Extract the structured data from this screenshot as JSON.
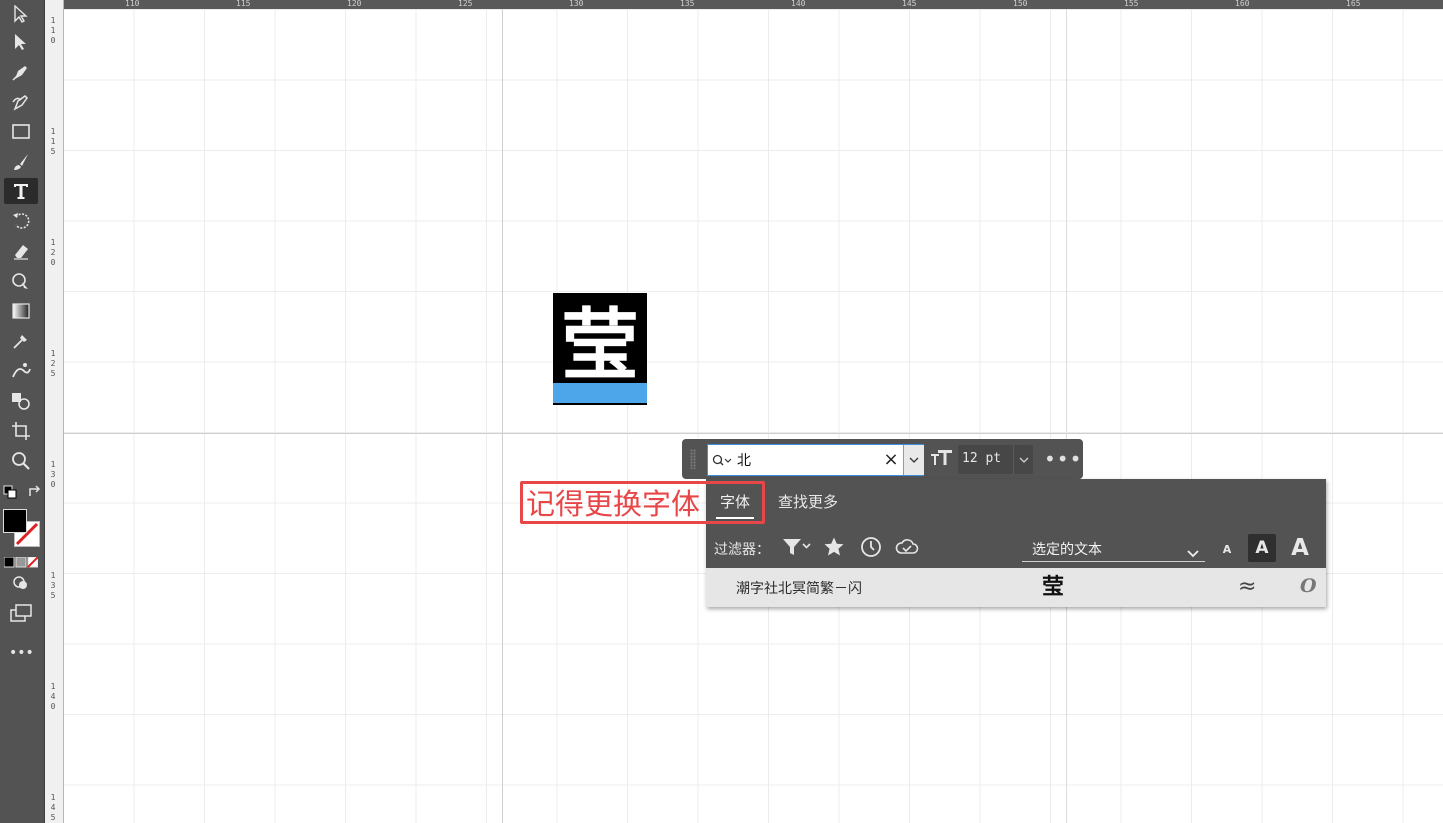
{
  "app": {
    "toolbar": {
      "tools": [
        {
          "name": "selection-tool-icon",
          "active": false
        },
        {
          "name": "direct-selection-tool-icon",
          "active": false
        },
        {
          "name": "pen-tool-icon",
          "active": false
        },
        {
          "name": "curvature-tool-icon",
          "active": false
        },
        {
          "name": "rectangle-tool-icon",
          "active": false
        },
        {
          "name": "paintbrush-tool-icon",
          "active": false
        },
        {
          "name": "type-tool-icon",
          "active": true
        },
        {
          "name": "rotate-tool-icon",
          "active": false
        },
        {
          "name": "eraser-tool-icon",
          "active": false
        },
        {
          "name": "warp-tool-icon",
          "active": false
        },
        {
          "name": "gradient-tool-icon",
          "active": false
        },
        {
          "name": "eyedropper-tool-icon",
          "active": false
        },
        {
          "name": "symbol-sprayer-tool-icon",
          "active": false
        },
        {
          "name": "shape-builder-tool-icon",
          "active": false
        },
        {
          "name": "artboard-tool-icon",
          "active": false
        },
        {
          "name": "zoom-tool-icon",
          "active": false
        }
      ],
      "fill_color": "#000000",
      "stroke": "none",
      "more_label": "•••"
    },
    "rulers": {
      "horizontal_ticks": [
        "110",
        "115",
        "120",
        "125",
        "130",
        "135",
        "140",
        "145",
        "150",
        "155",
        "160",
        "165"
      ],
      "vertical_ticks": [
        [
          "1",
          "1",
          "0"
        ],
        [
          "1",
          "1",
          "5"
        ],
        [
          "1",
          "2",
          "0"
        ],
        [
          "1",
          "2",
          "5"
        ],
        [
          "1",
          "3",
          "0"
        ],
        [
          "1",
          "3",
          "5"
        ],
        [
          "1",
          "4",
          "0"
        ],
        [
          "1",
          "4",
          "5"
        ]
      ]
    },
    "artwork": {
      "glyph": "莹",
      "background": "#000000",
      "selection_color": "#4da6ea"
    },
    "annotation": {
      "text": "记得更换字体",
      "color": "#e8474a"
    },
    "context_bar": {
      "search_value": "北",
      "clear_label": "×",
      "font_size_value": "12 pt",
      "more_label": "•••"
    },
    "font_panel": {
      "tabs": [
        {
          "label": "字体",
          "active": true
        },
        {
          "label": "查找更多",
          "active": false
        }
      ],
      "filter_label": "过滤器：",
      "sample_text_option": "选定的文本",
      "size_options": [
        "A",
        "A",
        "A"
      ],
      "results": [
        {
          "name": "潮字社北冥简繁－闪",
          "sample": "莹",
          "similar_icon": "≈",
          "type_icon": "O"
        }
      ]
    },
    "colors": {
      "ui_dark": "#535353",
      "accent": "#3c8ee0"
    }
  }
}
